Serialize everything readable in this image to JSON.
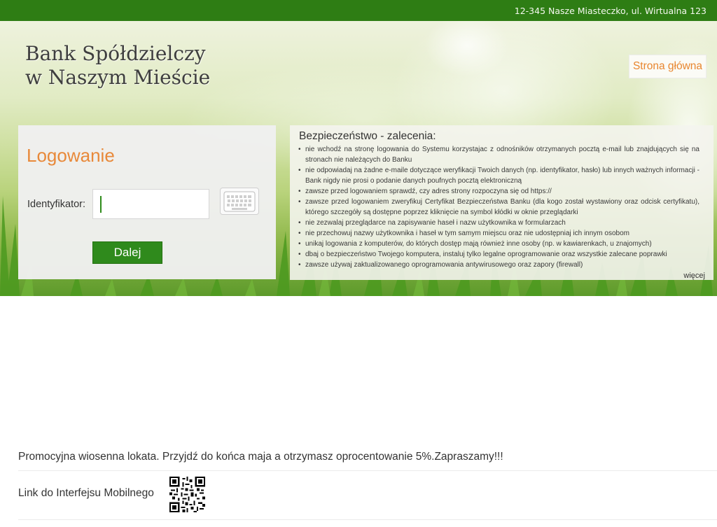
{
  "topbar": {
    "address": "12-345 Nasze Miasteczko, ul. Wirtualna 123"
  },
  "brand": {
    "line1": "Bank Spółdzielczy",
    "line2": "w Naszym Mieście"
  },
  "nav": {
    "home_label": "Strona główna"
  },
  "login": {
    "title": "Logowanie",
    "id_label": "Identyfikator:",
    "id_value": "",
    "keyboard_icon": "keyboard-icon",
    "next_label": "Dalej"
  },
  "security": {
    "title": "Bezpieczeństwo - zalecenia:",
    "items": [
      "nie wchodź na stronę logowania do Systemu korzystajac z odnośników otrzymanych pocztą e-mail lub znajdujących się na stronach nie należących do Banku",
      "nie odpowiadaj na żadne e-maile dotyczące weryfikacji Twoich danych (np. identyfikator, hasło) lub innych ważnych informacji - Bank nigdy nie prosi o podanie danych poufnych pocztą elektroniczną",
      "zawsze przed logowaniem sprawdź, czy adres strony rozpoczyna się od https://",
      "zawsze przed logowaniem zweryfikuj Certyfikat Bezpieczeństwa Banku (dla kogo został wystawiony oraz odcisk certyfikatu), którego szczegóły są dostępne poprzez kliknięcie na symbol kłódki w oknie przeglądarki",
      "nie zezwalaj przeglądarce na zapisywanie haseł i nazw użytkownika w formularzach",
      "nie przechowuj nazwy użytkownika i haseł w tym samym miejscu oraz nie udostępniaj ich innym osobom",
      "unikaj logowania z komputerów, do których dostęp mają również inne osoby (np. w kawiarenkach, u znajomych)",
      "dbaj o bezpieczeństwo Twojego komputera, instaluj tylko legalne oprogramowanie oraz wszystkie zalecane poprawki",
      "zawsze używaj zaktualizowanego oprogramowania antywirusowego oraz zapory (firewall)"
    ],
    "more_label": "więcej"
  },
  "footer": {
    "promo": "Promocyjna wiosenna lokata. Przyjdź do końca maja a otrzymasz oprocentowanie 5%.Zapraszamy!!!",
    "mobile_label": "Link do Interfejsu Mobilnego",
    "qr_icon": "qr-code-icon"
  },
  "colors": {
    "topbar": "#2e7d14",
    "accent_orange": "#e8893a",
    "button_green": "#2f8a1c"
  }
}
